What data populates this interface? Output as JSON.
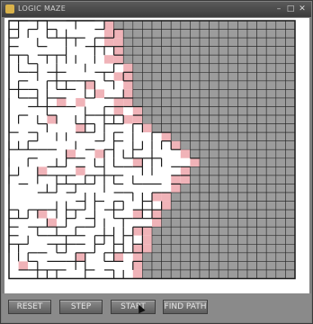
{
  "window": {
    "title": "LOGIC MAZE",
    "icon": "app-icon",
    "controls": {
      "minimize": "–",
      "restore": "□",
      "close": "✕"
    }
  },
  "maze": {
    "cols": 30,
    "rows": 30,
    "colors": {
      "unvisited": "#9c9c9c",
      "visited": "#ffffff",
      "frontier": "#f0b3b8",
      "wall": "#1a1a1a",
      "grid": "#2a2a2a"
    },
    "explored_cells_per_row": [
      11,
      12,
      12,
      12,
      12,
      13,
      13,
      13,
      13,
      13,
      14,
      14,
      15,
      17,
      18,
      19,
      20,
      19,
      19,
      18,
      17,
      17,
      16,
      16,
      15,
      15,
      15,
      14,
      14,
      14
    ]
  },
  "buttons": {
    "reset": "RESET",
    "step": "STEP",
    "start": "START",
    "find_path": "FIND PATH"
  }
}
